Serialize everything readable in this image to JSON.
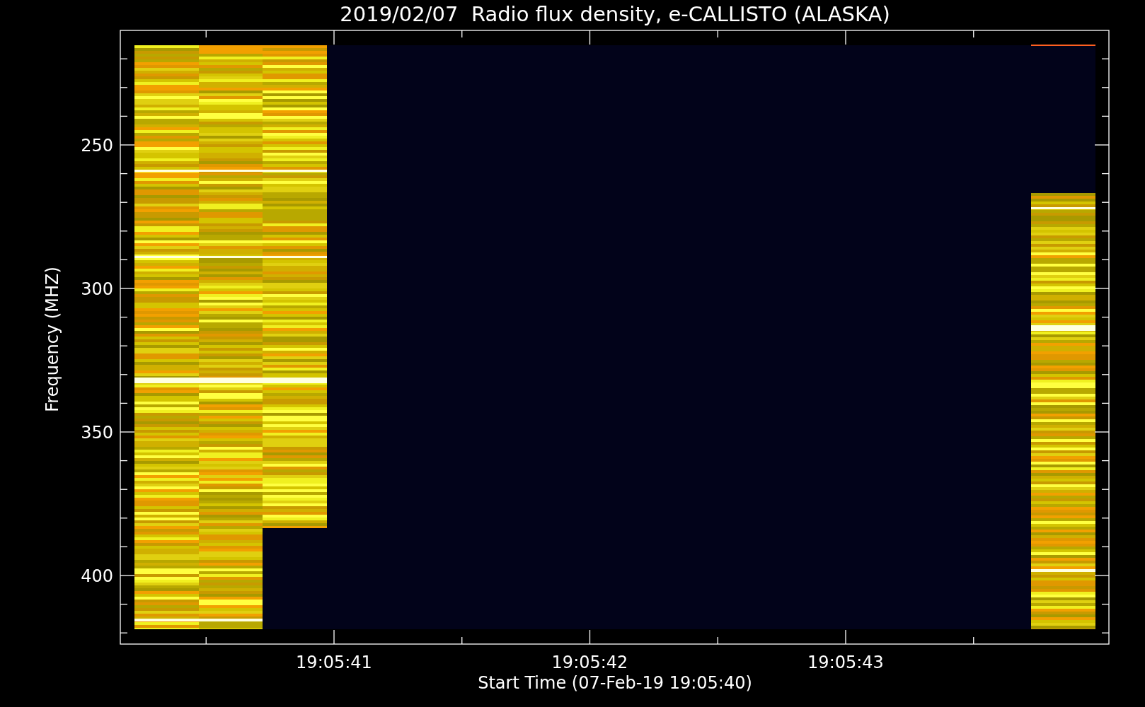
{
  "title": "2019/02/07  Radio flux density, e-CALLISTO (ALASKA)",
  "y_axis": {
    "label": "Frequency (MHZ)",
    "ticks": [
      "250",
      "300",
      "350",
      "400"
    ]
  },
  "x_axis": {
    "label": "Start Time (07-Feb-19 19:05:40)",
    "ticks": [
      "19:05:41",
      "19:05:42",
      "19:05:43"
    ]
  }
}
